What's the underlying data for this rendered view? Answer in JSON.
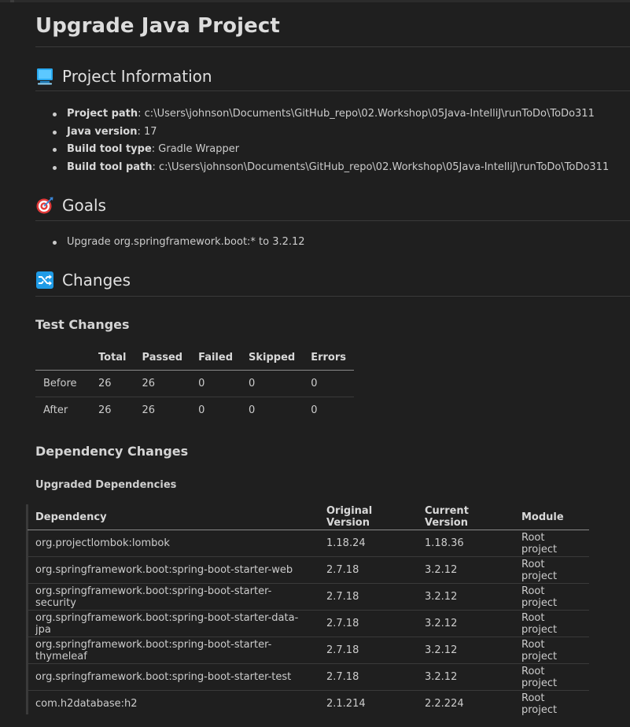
{
  "page": {
    "title": "Upgrade Java Project"
  },
  "project_info": {
    "heading": "Project Information",
    "icon": "computer-icon",
    "items": [
      {
        "label": "Project path",
        "value": "c:\\Users\\johnson\\Documents\\GitHub_repo\\02.Workshop\\05Java-IntelliJ\\runToDo\\ToDo311"
      },
      {
        "label": "Java version",
        "value": "17"
      },
      {
        "label": "Build tool type",
        "value": "Gradle Wrapper"
      },
      {
        "label": "Build tool path",
        "value": "c:\\Users\\johnson\\Documents\\GitHub_repo\\02.Workshop\\05Java-IntelliJ\\runToDo\\ToDo311"
      }
    ]
  },
  "goals": {
    "heading": "Goals",
    "icon": "target-icon",
    "items": [
      "Upgrade org.springframework.boot:* to 3.2.12"
    ]
  },
  "changes": {
    "heading": "Changes",
    "icon": "shuffle-icon",
    "test_changes": {
      "heading": "Test Changes",
      "columns": [
        "",
        "Total",
        "Passed",
        "Failed",
        "Skipped",
        "Errors"
      ],
      "rows": [
        [
          "Before",
          "26",
          "26",
          "0",
          "0",
          "0"
        ],
        [
          "After",
          "26",
          "26",
          "0",
          "0",
          "0"
        ]
      ]
    },
    "dependency_changes": {
      "heading": "Dependency Changes",
      "upgraded": {
        "heading": "Upgraded Dependencies",
        "columns": [
          "Dependency",
          "Original Version",
          "Current Version",
          "Module"
        ],
        "rows": [
          [
            "org.projectlombok:lombok",
            "1.18.24",
            "1.18.36",
            "Root project"
          ],
          [
            "org.springframework.boot:spring-boot-starter-web",
            "2.7.18",
            "3.2.12",
            "Root project"
          ],
          [
            "org.springframework.boot:spring-boot-starter-security",
            "2.7.18",
            "3.2.12",
            "Root project"
          ],
          [
            "org.springframework.boot:spring-boot-starter-data-jpa",
            "2.7.18",
            "3.2.12",
            "Root project"
          ],
          [
            "org.springframework.boot:spring-boot-starter-thymeleaf",
            "2.7.18",
            "3.2.12",
            "Root project"
          ],
          [
            "org.springframework.boot:spring-boot-starter-test",
            "2.7.18",
            "3.2.12",
            "Root project"
          ],
          [
            "com.h2database:h2",
            "2.1.214",
            "2.2.224",
            "Root project"
          ]
        ]
      }
    }
  },
  "colors": {
    "background": "#1f1f1f",
    "text": "#cccccc",
    "rule": "#3a3a3a",
    "computer_icon": "#29a9f0",
    "target_icon": "#e23b3b",
    "shuffle_icon": "#1f9be6"
  }
}
